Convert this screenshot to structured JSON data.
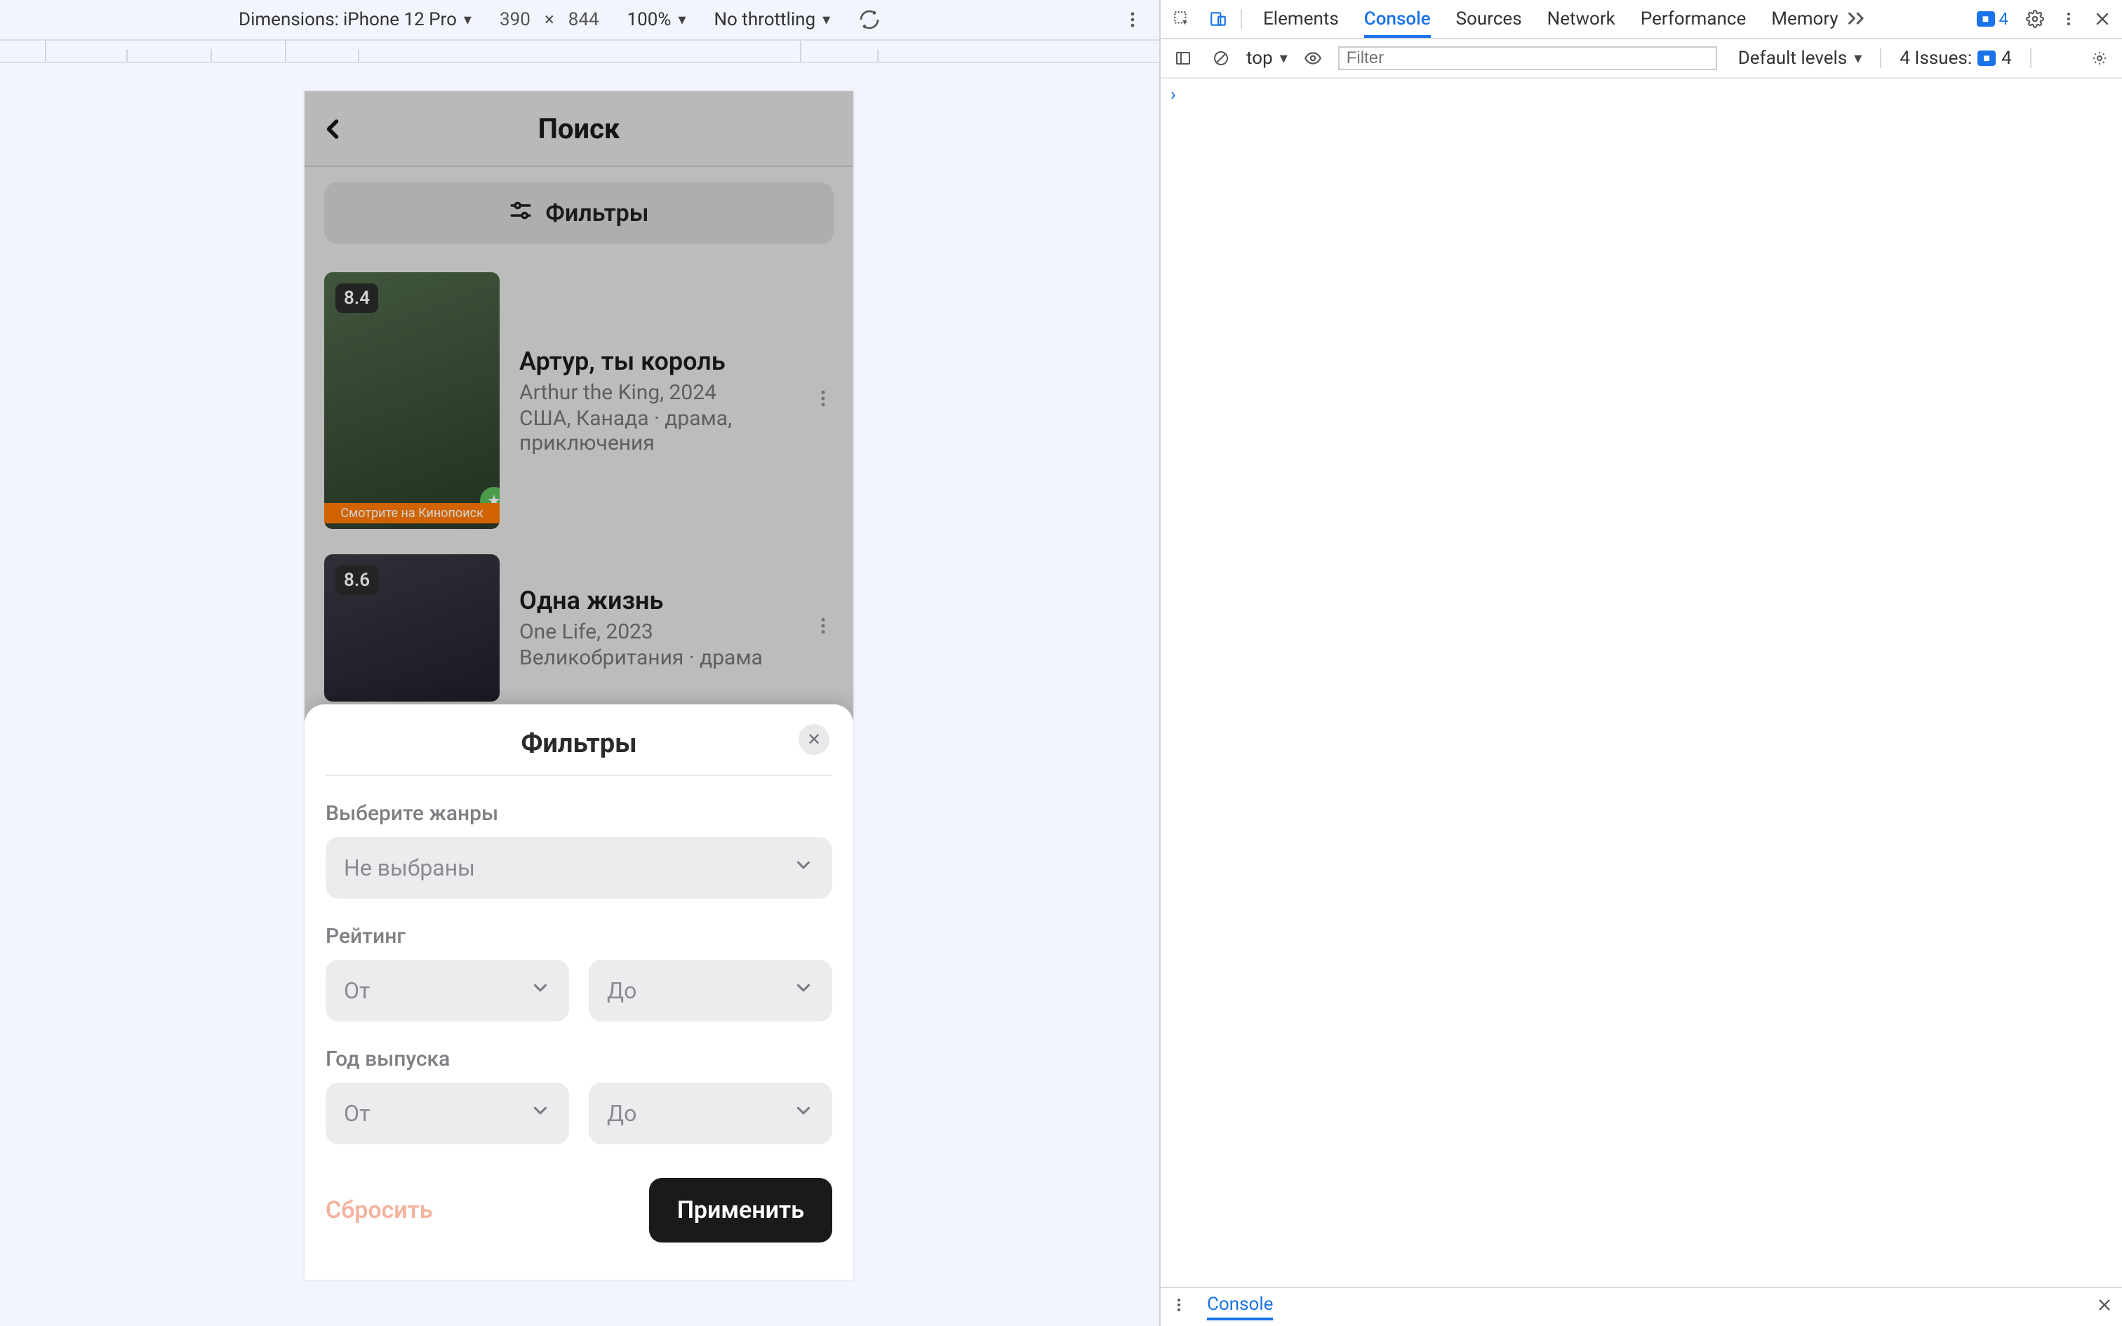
{
  "device_toolbar": {
    "dimensions_label": "Dimensions:",
    "device_name": "iPhone 12 Pro",
    "width": "390",
    "height": "844",
    "zoom": "100%",
    "throttling": "No throttling"
  },
  "phone": {
    "title": "Поиск",
    "filters_button": "Фильтры",
    "items": [
      {
        "rating": "8.4",
        "title": "Артур, ты король",
        "subtitle": "Arthur the King, 2024",
        "meta": "США, Канада · драма, приключения",
        "poster_banner": "Смотрите на Кинопоиск"
      },
      {
        "rating": "8.6",
        "title": "Одна жизнь",
        "subtitle": "One Life, 2023",
        "meta": "Великобритания · драма"
      }
    ]
  },
  "sheet": {
    "title": "Фильтры",
    "genres_label": "Выберите жанры",
    "genres_placeholder": "Не выбраны",
    "rating_label": "Рейтинг",
    "from_placeholder": "От",
    "to_placeholder": "До",
    "year_label": "Год выпуска",
    "reset": "Сбросить",
    "apply": "Применить"
  },
  "devtools": {
    "tabs": {
      "elements": "Elements",
      "console": "Console",
      "sources": "Sources",
      "network": "Network",
      "performance": "Performance",
      "memory": "Memory"
    },
    "badge_count_top": "4",
    "console_toolbar": {
      "context": "top",
      "filter_placeholder": "Filter",
      "levels": "Default levels",
      "issues_label": "4 Issues:",
      "issues_count": "4"
    },
    "drawer_label": "Console"
  }
}
